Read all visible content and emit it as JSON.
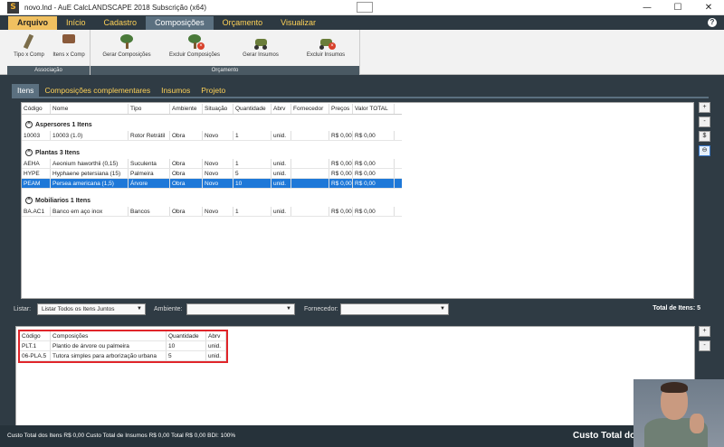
{
  "window": {
    "app_icon": "S",
    "title": "novo.lnd - AuE CalcLANDSCAPE 2018 Subscrição (x64)",
    "minimize": "—",
    "maximize": "☐",
    "close": "✕"
  },
  "menu": {
    "items": [
      "Arquivo",
      "Início",
      "Cadastro",
      "Composições",
      "Orçamento",
      "Visualizar"
    ],
    "active": "Composições",
    "help": "?"
  },
  "ribbon": {
    "groups": [
      {
        "label": "Associação",
        "buttons": [
          "Tipo x Comp",
          "Itens x Comp"
        ]
      },
      {
        "label": "Orçamento",
        "buttons": [
          "Gerar Composições",
          "Excluir Composições",
          "Gerar Insumos",
          "Excluir Insumos"
        ]
      }
    ]
  },
  "subtabs": [
    "Itens",
    "Composições complementares",
    "Insumos",
    "Projeto"
  ],
  "items_table": {
    "columns": [
      "Código",
      "Nome",
      "Tipo",
      "Ambiente",
      "Situação",
      "Quantidade",
      "Abrv",
      "Fornecedor",
      "Preços",
      "Valor TOTAL"
    ],
    "groups": [
      {
        "title": "Aspersores  1 Itens",
        "rows": [
          [
            "10003",
            "10003 (1.0)",
            "Rotor Retrátil",
            "Obra",
            "Novo",
            "1",
            "unid.",
            "",
            "R$ 0,00",
            "R$ 0,00"
          ]
        ]
      },
      {
        "title": "Plantas  3 Itens",
        "rows": [
          [
            "AEHA",
            "Aeonium haworthii (0,15)",
            "Suculenta",
            "Obra",
            "Novo",
            "1",
            "unid.",
            "",
            "R$ 0,00",
            "R$ 0,00"
          ],
          [
            "HYPE",
            "Hyphaene petersiana (15)",
            "Palmeira",
            "Obra",
            "Novo",
            "5",
            "unid.",
            "",
            "R$ 0,00",
            "R$ 0,00"
          ],
          [
            "PEAM",
            "Persea americana (1,5)",
            "Árvore",
            "Obra",
            "Novo",
            "10",
            "unid.",
            "",
            "R$ 0,00",
            "R$ 0,00"
          ]
        ]
      },
      {
        "title": "Mobiliarios  1 Itens",
        "rows": [
          [
            "BA.AC1",
            "Banco em aço inox",
            "Bancos",
            "Obra",
            "Novo",
            "1",
            "unid.",
            "",
            "R$ 0,00",
            "R$ 0,00"
          ]
        ]
      }
    ],
    "side_buttons": [
      "+",
      "-",
      "$",
      "⊖"
    ]
  },
  "filters": {
    "listar_label": "Listar:",
    "listar_value": "Listar Todos os Itens Juntos",
    "ambiente_label": "Ambiente:",
    "ambiente_value": "",
    "fornecedor_label": "Fornecedor:",
    "fornecedor_value": "",
    "total_items": "Total de Itens: 5"
  },
  "comp_table": {
    "columns": [
      "Código",
      "Composições",
      "Quantidade",
      "Abrv"
    ],
    "rows": [
      [
        "PLT.1",
        "Plantio de árvore ou palmeira",
        "10",
        "unid."
      ],
      [
        "06-PLA.5",
        "Tutora simples para arborização urbana",
        "5",
        "unid."
      ]
    ],
    "side_buttons": [
      "+",
      "-"
    ]
  },
  "status": {
    "text": "Custo Total dos Itens R$ 0,00   Custo Total de Insumos R$ 0,00   Total R$ 0,00   BDI: 100%",
    "big": "Custo Total do"
  },
  "colors": {
    "menu_text": "#ffd257",
    "selected_row": "#1e78d8",
    "highlight_box": "#e0252a"
  }
}
